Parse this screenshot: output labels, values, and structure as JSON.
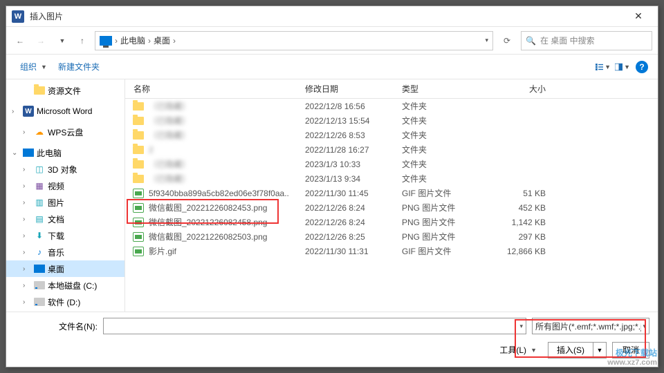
{
  "dialog": {
    "title": "插入图片"
  },
  "nav": {
    "path_parts": [
      "此电脑",
      "桌面"
    ],
    "search_placeholder": "在 桌面 中搜索"
  },
  "toolbar": {
    "organize": "组织",
    "new_folder": "新建文件夹"
  },
  "sidebar": {
    "items": [
      {
        "label": "资源文件",
        "icon": "folder",
        "indent": 1,
        "expand": ""
      },
      {
        "label": "Microsoft Word",
        "icon": "word",
        "indent": 0,
        "expand": ">"
      },
      {
        "label": "WPS云盘",
        "icon": "cloud",
        "indent": 1,
        "expand": ">"
      },
      {
        "label": "此电脑",
        "icon": "pc",
        "indent": 0,
        "expand": "v"
      },
      {
        "label": "3D 对象",
        "icon": "cube",
        "indent": 1,
        "expand": ">"
      },
      {
        "label": "视频",
        "icon": "video",
        "indent": 1,
        "expand": ">"
      },
      {
        "label": "图片",
        "icon": "picture",
        "indent": 1,
        "expand": ">"
      },
      {
        "label": "文档",
        "icon": "doc",
        "indent": 1,
        "expand": ">"
      },
      {
        "label": "下载",
        "icon": "download",
        "indent": 1,
        "expand": ">"
      },
      {
        "label": "音乐",
        "icon": "music",
        "indent": 1,
        "expand": ">"
      },
      {
        "label": "桌面",
        "icon": "desktop",
        "indent": 1,
        "expand": ">",
        "selected": true
      },
      {
        "label": "本地磁盘 (C:)",
        "icon": "drive",
        "indent": 1,
        "expand": ">"
      },
      {
        "label": "软件 (D:)",
        "icon": "drive",
        "indent": 1,
        "expand": ">"
      }
    ]
  },
  "columns": {
    "name": "名称",
    "date": "修改日期",
    "type": "类型",
    "size": "大小"
  },
  "files": [
    {
      "name": "（已隐藏）",
      "date": "2022/12/8 16:56",
      "type": "文件夹",
      "size": "",
      "icon": "folder",
      "blurred": true
    },
    {
      "name": "（已隐藏）",
      "date": "2022/12/13 15:54",
      "type": "文件夹",
      "size": "",
      "icon": "folder",
      "blurred": true
    },
    {
      "name": "（已隐藏）",
      "date": "2022/12/26 8:53",
      "type": "文件夹",
      "size": "",
      "icon": "folder",
      "blurred": true
    },
    {
      "name": "2",
      "date": "2022/11/28 16:27",
      "type": "文件夹",
      "size": "",
      "icon": "folder",
      "blurred": true
    },
    {
      "name": "（已隐藏）",
      "date": "2023/1/3 10:33",
      "type": "文件夹",
      "size": "",
      "icon": "folder",
      "blurred": true
    },
    {
      "name": "（已隐藏）",
      "date": "2023/1/13 9:34",
      "type": "文件夹",
      "size": "",
      "icon": "folder",
      "blurred": true
    },
    {
      "name": "5f9340bba899a5cb82ed06e3f78f0aa..",
      "date": "2022/11/30 11:45",
      "type": "GIF 图片文件",
      "size": "51 KB",
      "icon": "gif"
    },
    {
      "name": "微信截图_20221226082453.png",
      "date": "2022/12/26 8:24",
      "type": "PNG 图片文件",
      "size": "452 KB",
      "icon": "png"
    },
    {
      "name": "微信截图_20221226082458.png",
      "date": "2022/12/26 8:24",
      "type": "PNG 图片文件",
      "size": "1,142 KB",
      "icon": "png"
    },
    {
      "name": "微信截图_20221226082503.png",
      "date": "2022/12/26 8:25",
      "type": "PNG 图片文件",
      "size": "297 KB",
      "icon": "png"
    },
    {
      "name": "影片.gif",
      "date": "2022/11/30 11:31",
      "type": "GIF 图片文件",
      "size": "12,866 KB",
      "icon": "gif"
    }
  ],
  "bottom": {
    "filename_label": "文件名(N):",
    "filter_label": "所有图片(*.emf;*.wmf;*.jpg;*.jpeg;*.png;*.gif)",
    "tools": "工具(L)",
    "insert": "插入(S)",
    "cancel": "取消"
  },
  "watermark": {
    "brand": "极光下载站",
    "url": "www.xz7.com"
  }
}
